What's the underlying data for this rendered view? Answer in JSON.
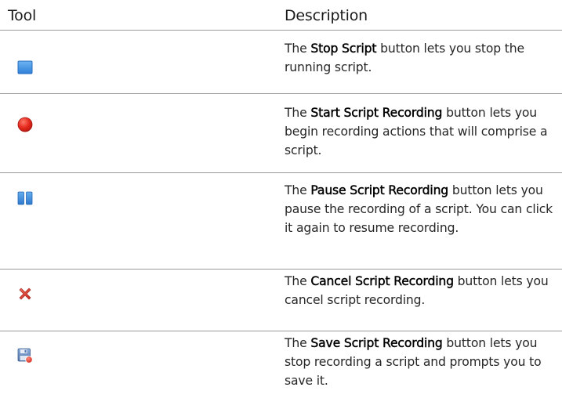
{
  "table": {
    "headers": {
      "tool": "Tool",
      "description": "Description"
    },
    "rows": [
      {
        "icon": "stop-square-icon",
        "prefix": "The ",
        "name": "Stop Script",
        "suffix": " button lets you stop the running script."
      },
      {
        "icon": "record-circle-icon",
        "prefix": "The ",
        "name": "Start Script Recording",
        "suffix": " button lets you begin recording actions that will comprise a script."
      },
      {
        "icon": "pause-bars-icon",
        "prefix": "The ",
        "name": "Pause Script Recording",
        "suffix": " button lets you pause the recording of a script. You can click it again to resume recording."
      },
      {
        "icon": "cancel-x-icon",
        "prefix": "The ",
        "name": "Cancel Script Recording",
        "suffix": " button lets you cancel script recording."
      },
      {
        "icon": "save-disk-record-icon",
        "prefix": "The ",
        "name": "Save Script Recording",
        "suffix": " button lets you stop recording a script and prompts you to save it."
      }
    ]
  },
  "colors": {
    "stop_blue": "#3f8ee0",
    "record_red": "#e02020",
    "pause_blue": "#3a86d6",
    "cancel_red": "#d8342a",
    "disk_blue": "#6a8fc0"
  }
}
